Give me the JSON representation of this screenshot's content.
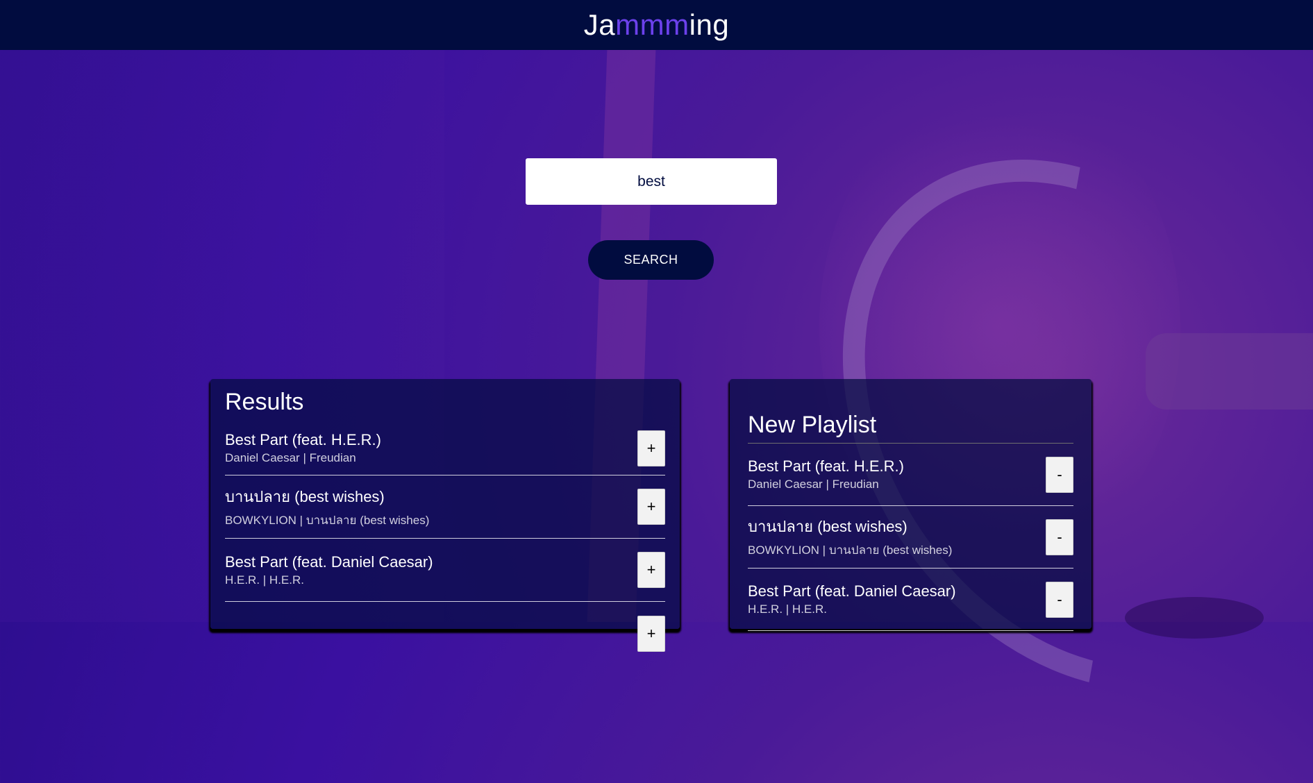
{
  "app": {
    "logo_prefix": "Ja",
    "logo_highlight": "mmm",
    "logo_suffix": "ing"
  },
  "search": {
    "value": "best",
    "button_label": "SEARCH"
  },
  "results": {
    "title": "Results",
    "tracks": [
      {
        "name": "Best Part (feat. H.E.R.)",
        "sub": "Daniel Caesar | Freudian",
        "action": "+"
      },
      {
        "name": "บานปลาย (best wishes)",
        "sub": "BOWKYLION | บานปลาย (best wishes)",
        "action": "+"
      },
      {
        "name": "Best Part (feat. Daniel Caesar)",
        "sub": "H.E.R. | H.E.R.",
        "action": "+"
      },
      {
        "name": "",
        "sub": "",
        "action": "+"
      }
    ]
  },
  "playlist": {
    "name": "New Playlist",
    "tracks": [
      {
        "name": "Best Part (feat. H.E.R.)",
        "sub": "Daniel Caesar | Freudian",
        "action": "-"
      },
      {
        "name": "บานปลาย (best wishes)",
        "sub": "BOWKYLION | บานปลาย (best wishes)",
        "action": "-"
      },
      {
        "name": "Best Part (feat. Daniel Caesar)",
        "sub": "H.E.R. | H.E.R.",
        "action": "-"
      }
    ]
  },
  "colors": {
    "header_bg": "#010c3f",
    "accent": "#6c41ec",
    "button_bg": "#010c3f"
  }
}
